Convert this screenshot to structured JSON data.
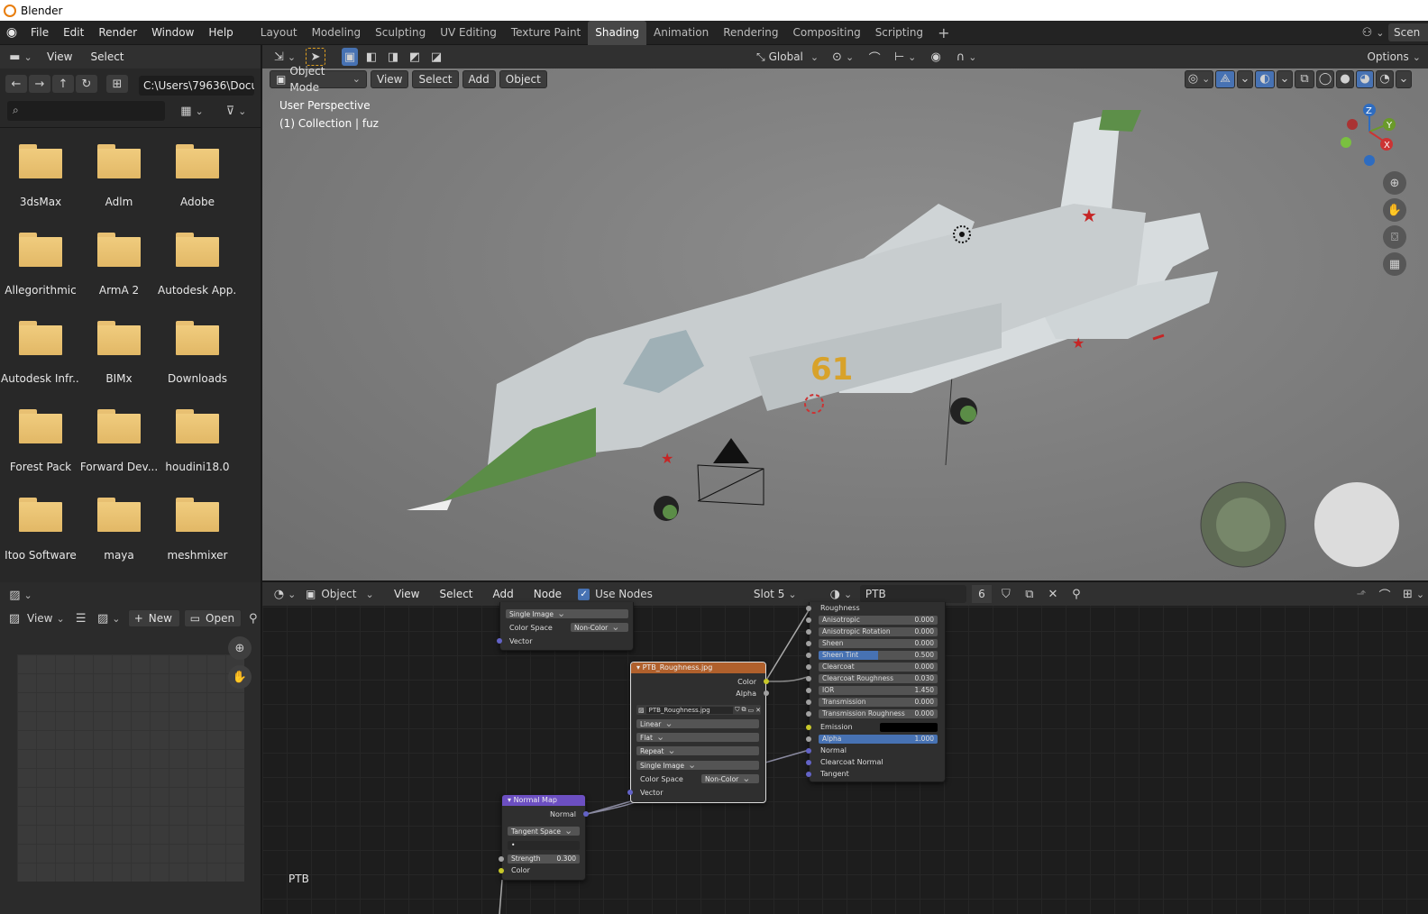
{
  "app": {
    "title": "Blender"
  },
  "menu": [
    "File",
    "Edit",
    "Render",
    "Window",
    "Help"
  ],
  "workspaces": [
    "Layout",
    "Modeling",
    "Sculpting",
    "UV Editing",
    "Texture Paint",
    "Shading",
    "Animation",
    "Rendering",
    "Compositing",
    "Scripting"
  ],
  "active_workspace": "Shading",
  "scene_label": "Scen",
  "file_browser": {
    "menus": [
      "View",
      "Select"
    ],
    "path": "C:\\Users\\79636\\Docu...",
    "folders": [
      "3dsMax",
      "Adlm",
      "Adobe",
      "Allegorithmic",
      "ArmA 2",
      "Autodesk App...",
      "Autodesk Infr...",
      "BIMx",
      "Downloads",
      "Forest Pack",
      "Forward Dev...",
      "houdini18.0",
      "Itoo Software",
      "maya",
      "meshmixer"
    ]
  },
  "viewport": {
    "orientation": "Global",
    "options": "Options",
    "mode": "Object Mode",
    "menus": [
      "View",
      "Select",
      "Add",
      "Object"
    ],
    "perspective": "User Perspective",
    "collection": "(1) Collection | fuz",
    "gizmo": {
      "x": "X",
      "y": "Y",
      "z": "Z"
    },
    "jet_number": "61"
  },
  "image_editor": {
    "view": "View",
    "new": "New",
    "open": "Open"
  },
  "node_editor": {
    "type": "Object",
    "menus": [
      "View",
      "Select",
      "Add",
      "Node"
    ],
    "use_nodes": "Use Nodes",
    "slot": "Slot 5",
    "material": "PTB",
    "users": "6",
    "footer_label": "PTB",
    "top_node": {
      "projection": "Single Image",
      "color_space_label": "Color Space",
      "color_space": "Non-Color",
      "vector": "Vector"
    },
    "roughness_node": {
      "title": "PTB_Roughness.jpg",
      "out_color": "Color",
      "out_alpha": "Alpha",
      "image": "PTB_Roughness.jpg",
      "interpolation": "Linear",
      "projection": "Flat",
      "extension": "Repeat",
      "source": "Single Image",
      "color_space_label": "Color Space",
      "color_space": "Non-Color",
      "vector": "Vector"
    },
    "normalmap_node": {
      "title": "Normal Map",
      "out": "Normal",
      "space": "Tangent Space",
      "strength_label": "Strength",
      "strength": "0.300",
      "color": "Color"
    },
    "bsdf": {
      "roughness": "Roughness",
      "props": [
        {
          "label": "Anisotropic",
          "value": "0.000"
        },
        {
          "label": "Anisotropic Rotation",
          "value": "0.000"
        },
        {
          "label": "Sheen",
          "value": "0.000"
        },
        {
          "label": "Sheen Tint",
          "value": "0.500"
        },
        {
          "label": "Clearcoat",
          "value": "0.000"
        },
        {
          "label": "Clearcoat Roughness",
          "value": "0.030"
        },
        {
          "label": "IOR",
          "value": "1.450"
        },
        {
          "label": "Transmission",
          "value": "0.000"
        },
        {
          "label": "Transmission Roughness",
          "value": "0.000"
        }
      ],
      "emission": "Emission",
      "alpha": {
        "label": "Alpha",
        "value": "1.000"
      },
      "inputs": [
        "Normal",
        "Clearcoat Normal",
        "Tangent"
      ]
    }
  },
  "colors": {
    "accent": "#4772b3",
    "normalmap_header": "#6c4fc2",
    "texture_header": "#b0602c",
    "folder": "#e8c072"
  }
}
